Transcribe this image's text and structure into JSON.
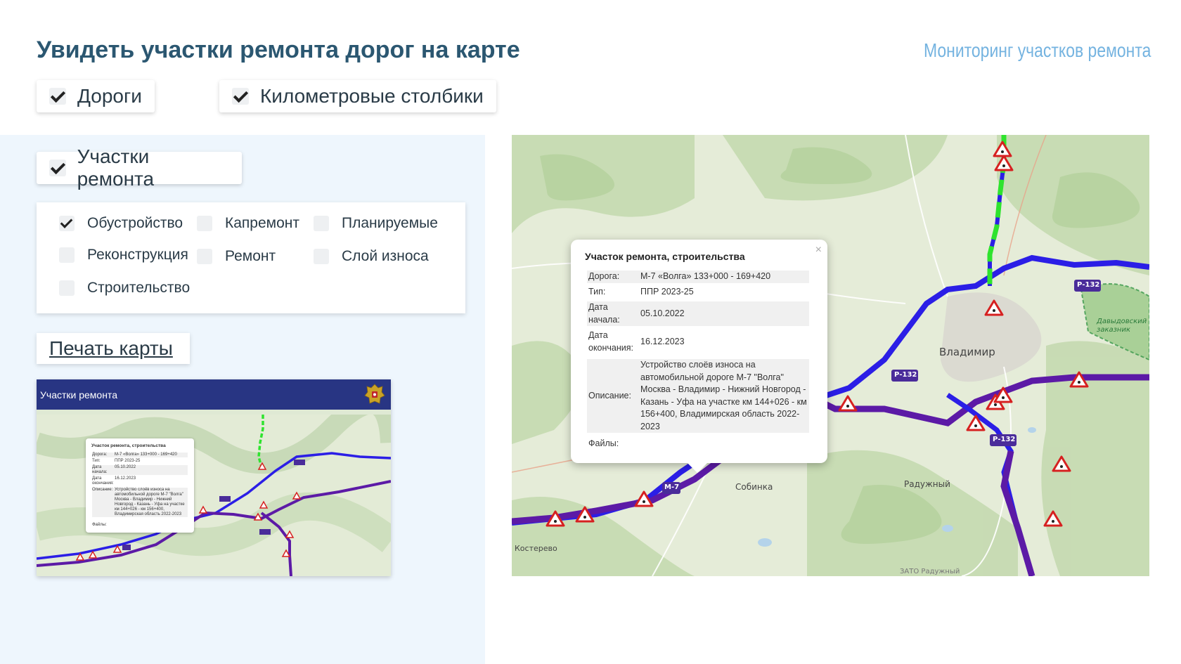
{
  "header": {
    "title": "Увидеть участки ремонта дорог на карте",
    "subtitle": "Мониторинг участков ремонта"
  },
  "layers": {
    "roads": {
      "label": "Дороги",
      "checked": true
    },
    "km_posts": {
      "label": "Километровые столбики",
      "checked": true
    },
    "repair_sections": {
      "label": "Участки ремонта",
      "checked": true
    }
  },
  "repair_types": [
    {
      "label": "Обустройство",
      "checked": true
    },
    {
      "label": "Капремонт",
      "checked": false
    },
    {
      "label": "Планируемые",
      "checked": false
    },
    {
      "label": "Реконструкция",
      "checked": false
    },
    {
      "label": "Ремонт",
      "checked": false
    },
    {
      "label": "Слой износа",
      "checked": false
    },
    {
      "label": "Строительство",
      "checked": false
    }
  ],
  "print_button": "Печать карты",
  "thumbnail": {
    "title": "Участки ремонта"
  },
  "popup": {
    "title": "Участок ремонта, строительства",
    "close": "×",
    "road_label": "Дорога:",
    "road_value": "М-7 «Волга» 133+000 - 169+420",
    "type_label": "Тип:",
    "type_value": "ППР 2023-25",
    "start_label": "Дата начала:",
    "start_value": "05.10.2022",
    "end_label": "Дата окончания:",
    "end_value": "16.12.2023",
    "desc_label": "Описание:",
    "desc_value": "Устройство слоёв износа на автомобильной дороге М-7 \"Волга\" Москва - Владимир - Нижний Новгород - Казань - Уфа на участке км 144+026 - км 156+400, Владимирская область 2022-2023",
    "files_label": "Файлы:"
  },
  "map_labels": {
    "vladimir": "Владимир",
    "sobinka": "Собинка",
    "raduzhny": "Радужный",
    "kosterevo": "Костерево",
    "zato": "ЗАТО Радужный",
    "reserve": "Давыдовский заказник",
    "r132": "Р-132",
    "m7": "М-7"
  },
  "colors": {
    "road_blue": "#2b1ee6",
    "road_purple": "#5c1aa6",
    "road_green": "#2ee32e",
    "repair_sign": "#d62020",
    "title": "#2b5771",
    "accent": "#74b3e0"
  }
}
